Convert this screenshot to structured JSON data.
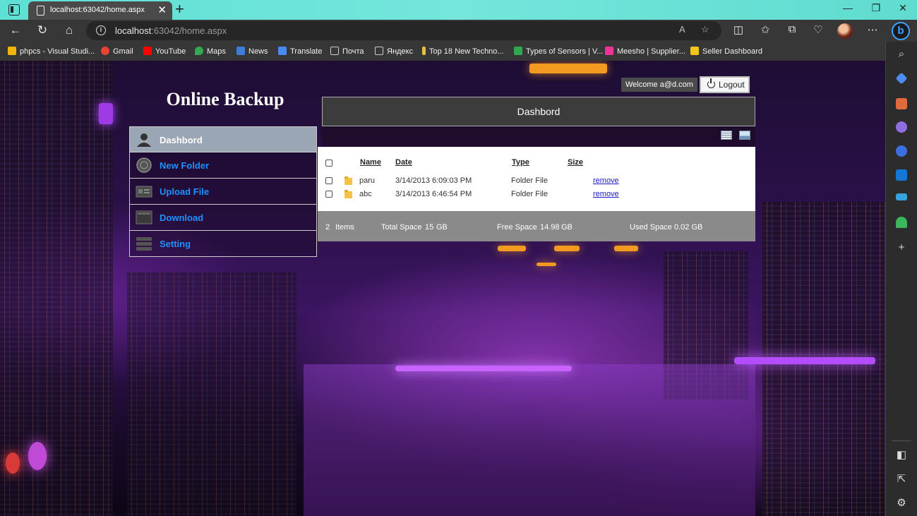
{
  "browser": {
    "tab_title": "localhost:63042/home.aspx",
    "tab_close": "✕",
    "new_tab": "+",
    "url_host": "localhost",
    "url_path": ":63042/home.aspx",
    "bookmarks": [
      {
        "label": "phpcs - Visual Studi...",
        "icon": "windows-icon",
        "color": "#f4b400"
      },
      {
        "label": "Gmail",
        "icon": "google-icon",
        "color": "#ea4335"
      },
      {
        "label": "YouTube",
        "icon": "youtube-icon",
        "color": "#ff0000"
      },
      {
        "label": "Maps",
        "icon": "maps-icon",
        "color": "#34a853"
      },
      {
        "label": "News",
        "icon": "news-icon",
        "color": "#3b7dd8"
      },
      {
        "label": "Translate",
        "icon": "translate-icon",
        "color": "#4a8af4"
      },
      {
        "label": "Почта",
        "icon": "page-icon",
        "color": "#cccccc"
      },
      {
        "label": "Яндекс",
        "icon": "page-icon",
        "color": "#cccccc"
      },
      {
        "label": "Top 18 New Techno...",
        "icon": "bookmark-icon",
        "color": "#e0c341"
      },
      {
        "label": "Types of Sensors | V...",
        "icon": "bookmark-icon",
        "color": "#2fa84f"
      },
      {
        "label": "Meesho | Supplier...",
        "icon": "meesho-icon",
        "color": "#f43397"
      },
      {
        "label": "Seller Dashboard",
        "icon": "dashboard-icon",
        "color": "#f5c518"
      }
    ]
  },
  "app": {
    "title": "Online Backup",
    "welcome": "Welcome a@d.com",
    "logout_label": "Logout",
    "menu": [
      {
        "label": "Dashbord",
        "icon": "user-icon"
      },
      {
        "label": "New Folder",
        "icon": "folder-seal-icon"
      },
      {
        "label": "Upload File",
        "icon": "upload-icon"
      },
      {
        "label": "Download",
        "icon": "download-icon"
      },
      {
        "label": "Setting",
        "icon": "settings-icon"
      }
    ],
    "panel_title": "Dashbord",
    "columns": {
      "name": "Name",
      "date": "Date",
      "type": "Type",
      "size": "Size"
    },
    "files": [
      {
        "name": "paru",
        "date": "3/14/2013 6:09:03 PM",
        "type": "Folder File",
        "size": "",
        "action": "remove"
      },
      {
        "name": "abc",
        "date": "3/14/2013 6:46:54 PM",
        "type": "Folder File",
        "size": "",
        "action": "remove"
      }
    ],
    "footer": {
      "count": "2",
      "items_label": "Items",
      "total_label": "Total Space",
      "total_value": "15",
      "total_unit": "GB",
      "free_label": "Free Space",
      "free_value": "14.98",
      "free_unit": "GB",
      "used_label": "Used Space",
      "used_value": "0.02 GB"
    }
  }
}
